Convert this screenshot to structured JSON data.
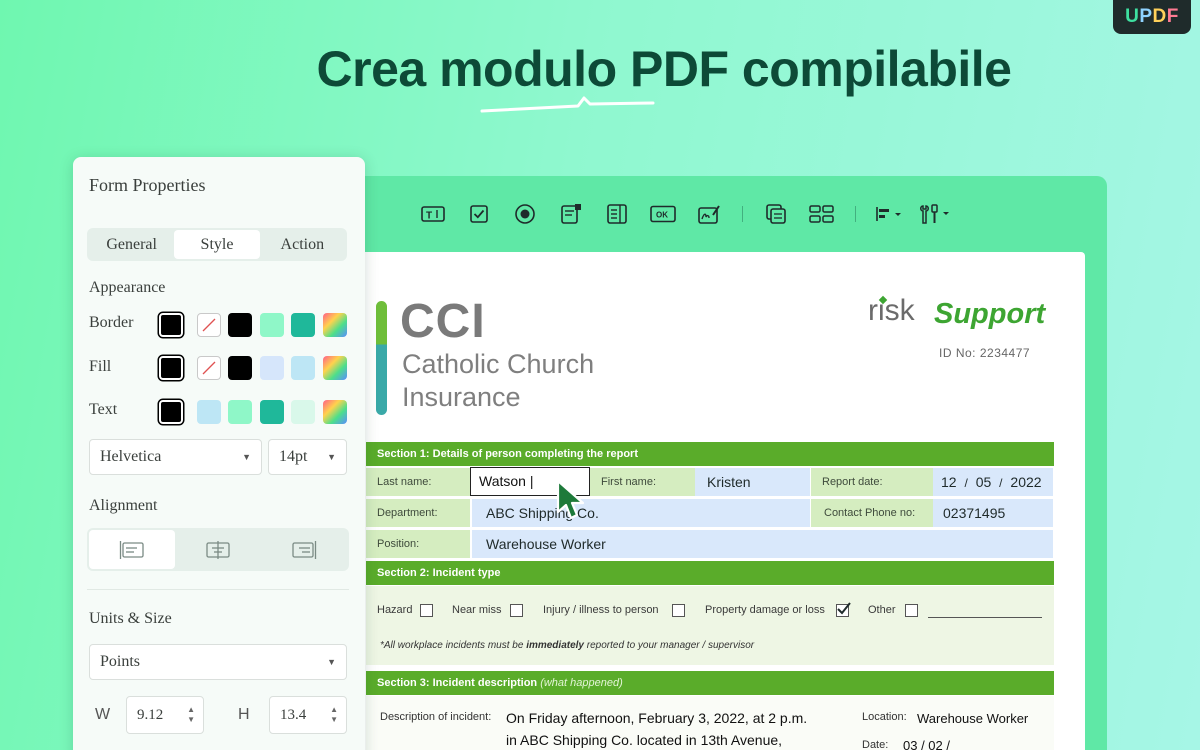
{
  "brand": {
    "u": "U",
    "p": "P",
    "d": "D",
    "f": "F"
  },
  "headline": "Crea modulo PDF compilabile",
  "colors": {
    "accent": "#5aac2a",
    "background": "#8ff8cf",
    "editor": "#5fe8a6",
    "headline": "#0d4a37"
  },
  "toolbar": {
    "icons": [
      "text-field-icon",
      "checkbox-icon",
      "radio-button-icon",
      "combo-box-icon",
      "list-box-icon",
      "button-icon",
      "signature-icon",
      "duplicate-icon",
      "grid-icon",
      "align-icon",
      "tools-icon"
    ],
    "button_label": "OK",
    "text_label": "T"
  },
  "document": {
    "logo_abbr": "CCI",
    "logo_line1": "Catholic Church",
    "logo_line2": "Insurance",
    "risk": "risk",
    "support": "Support",
    "id_no": "ID No: 2234477",
    "section1": {
      "title": "Section 1: Details of person completing the report",
      "last_name_label": "Last name:",
      "last_name_value": "Watson |",
      "first_name_label": "First name:",
      "first_name_value": "Kristen",
      "report_date_label": "Report date:",
      "date_day": "12",
      "date_month": "05",
      "date_year": "2022",
      "date_sep": "/",
      "department_label": "Department:",
      "department_value": "ABC Shipping Co.",
      "phone_label": "Contact Phone no:",
      "phone_value": "02371495",
      "position_label": "Position:",
      "position_value": "Warehouse Worker"
    },
    "section2": {
      "title": "Section 2: Incident type",
      "options": [
        {
          "label": "Hazard",
          "checked": false
        },
        {
          "label": "Near miss",
          "checked": false
        },
        {
          "label": "Injury / illness to person",
          "checked": false
        },
        {
          "label": "Property damage or loss",
          "checked": true
        },
        {
          "label": "Other",
          "checked": false
        }
      ],
      "note_prefix": "*All workplace incidents must be ",
      "note_emph": "immediately",
      "note_suffix": " reported to your manager / supervisor"
    },
    "section3": {
      "title": "Section 3: Incident description",
      "title_hint": "(what happened)",
      "desc_label": "Description of incident:",
      "desc_line1": "On Friday afternoon, February 3, 2022, at 2 p.m.",
      "desc_line2": "in ABC Shipping Co. located in 13th Avenue,",
      "location_label": "Location:",
      "location_value": "Warehouse Worker",
      "date_label": "Date:",
      "date_value": "03   /   02   /"
    }
  },
  "panel": {
    "title": "Form Properties",
    "tabs": [
      "General",
      "Style",
      "Action"
    ],
    "active_tab": "Style",
    "appearance": "Appearance",
    "border": "Border",
    "fill": "Fill",
    "text": "Text",
    "swatches": {
      "border": [
        "#000000",
        "none",
        "#000000",
        "#8ff7c8",
        "#1fb89a",
        "gradient"
      ],
      "fill": [
        "#000000",
        "none",
        "#000000",
        "#d6e6fb",
        "#bde6f5",
        "gradient"
      ],
      "text": [
        "#000000",
        "#bde6f5",
        "#8ff7c8",
        "#1fb89a",
        "#d9f8ea",
        "gradient"
      ]
    },
    "font": "Helvetica",
    "font_size": "14pt",
    "alignment": "Alignment",
    "alignment_icons": [
      "align-left-icon",
      "align-center-icon",
      "align-right-icon"
    ],
    "units_size": "Units & Size",
    "units": "Points",
    "w_label": "W",
    "w_value": "9.12",
    "h_label": "H",
    "h_value": "13.4"
  }
}
